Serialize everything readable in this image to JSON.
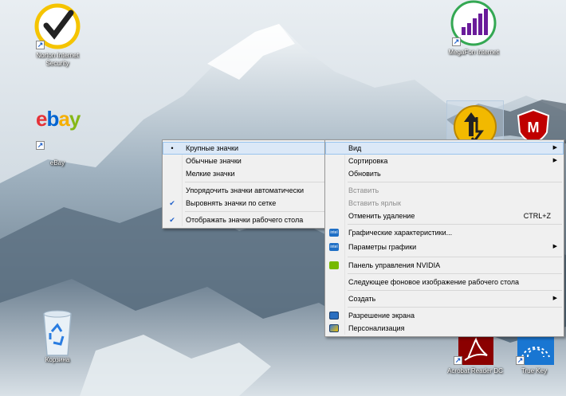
{
  "desktop_icons": {
    "norton": {
      "label_line1": "Norton Internet",
      "label_line2": "Security"
    },
    "megafon": {
      "label": "MegaFon Internet"
    },
    "ebay": {
      "logo": "ebay",
      "label": "eBay"
    },
    "recycle_bin": {
      "label": "Корзина"
    },
    "acrobat": {
      "label": "Acrobat Reader DC"
    },
    "truekey": {
      "label": "True Key"
    }
  },
  "view_submenu": {
    "items": [
      {
        "label": "Крупные значки",
        "mark": "•"
      },
      {
        "label": "Обычные значки",
        "mark": ""
      },
      {
        "label": "Мелкие значки",
        "mark": ""
      },
      {
        "label": "Упорядочить значки автоматически",
        "mark": ""
      },
      {
        "label": "Выровнять значки по сетке",
        "mark": "✔"
      },
      {
        "label": "Отображать значки рабочего стола",
        "mark": "✔"
      }
    ]
  },
  "context_menu": {
    "view": "Вид",
    "sort": "Сортировка",
    "refresh": "Обновить",
    "paste": "Вставить",
    "paste_shortcut": "Вставить ярлык",
    "undo_delete": "Отменить удаление",
    "undo_delete_key": "CTRL+Z",
    "graphics_props": "Графические характеристики...",
    "graphics_params": "Параметры графики",
    "nvidia_panel": "Панель управления NVIDIA",
    "next_background": "Следующее фоновое изображение рабочего стола",
    "create": "Создать",
    "screen_resolution": "Разрешение экрана",
    "personalize": "Персонализация"
  },
  "colors": {
    "highlight": "#dbe8f7",
    "norton_yellow": "#f5c400",
    "megafon_green": "#34a853",
    "megafon_purple": "#6a1b9a",
    "mcafee_red": "#c00000",
    "truekey_blue": "#1976d2"
  }
}
